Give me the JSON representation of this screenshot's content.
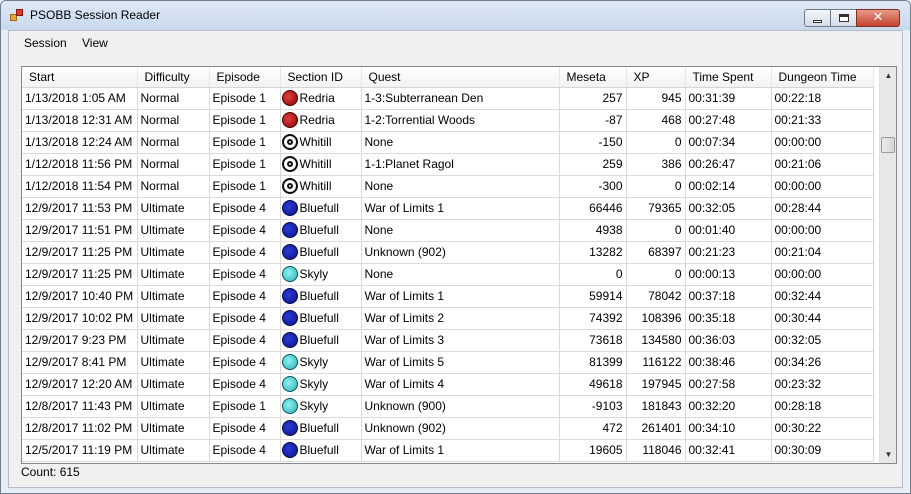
{
  "window": {
    "title": "PSOBB Session Reader"
  },
  "menu": {
    "items": [
      "Session",
      "View"
    ]
  },
  "columns": [
    "Start",
    "Difficulty",
    "Episode",
    "Section ID",
    "Quest",
    "Meseta",
    "XP",
    "Time Spent",
    "Dungeon Time"
  ],
  "section_icons": {
    "Redria": "red",
    "Whitill": "white",
    "Bluefull": "blue",
    "Skyly": "cyan"
  },
  "rows": [
    [
      "1/13/2018 1:05 AM",
      "Normal",
      "Episode 1",
      "Redria",
      "1-3:Subterranean Den",
      "257",
      "945",
      "00:31:39",
      "00:22:18"
    ],
    [
      "1/13/2018 12:31 AM",
      "Normal",
      "Episode 1",
      "Redria",
      "1-2:Torrential Woods",
      "-87",
      "468",
      "00:27:48",
      "00:21:33"
    ],
    [
      "1/13/2018 12:24 AM",
      "Normal",
      "Episode 1",
      "Whitill",
      "None",
      "-150",
      "0",
      "00:07:34",
      "00:00:00"
    ],
    [
      "1/12/2018 11:56 PM",
      "Normal",
      "Episode 1",
      "Whitill",
      "1-1:Planet Ragol",
      "259",
      "386",
      "00:26:47",
      "00:21:06"
    ],
    [
      "1/12/2018 11:54 PM",
      "Normal",
      "Episode 1",
      "Whitill",
      "None",
      "-300",
      "0",
      "00:02:14",
      "00:00:00"
    ],
    [
      "12/9/2017 11:53 PM",
      "Ultimate",
      "Episode 4",
      "Bluefull",
      "War of Limits 1",
      "66446",
      "79365",
      "00:32:05",
      "00:28:44"
    ],
    [
      "12/9/2017 11:51 PM",
      "Ultimate",
      "Episode 4",
      "Bluefull",
      "None",
      "4938",
      "0",
      "00:01:40",
      "00:00:00"
    ],
    [
      "12/9/2017 11:25 PM",
      "Ultimate",
      "Episode 4",
      "Bluefull",
      "Unknown (902)",
      "13282",
      "68397",
      "00:21:23",
      "00:21:04"
    ],
    [
      "12/9/2017 11:25 PM",
      "Ultimate",
      "Episode 4",
      "Skyly",
      "None",
      "0",
      "0",
      "00:00:13",
      "00:00:00"
    ],
    [
      "12/9/2017 10:40 PM",
      "Ultimate",
      "Episode 4",
      "Bluefull",
      "War of Limits 1",
      "59914",
      "78042",
      "00:37:18",
      "00:32:44"
    ],
    [
      "12/9/2017 10:02 PM",
      "Ultimate",
      "Episode 4",
      "Bluefull",
      "War of Limits 2",
      "74392",
      "108396",
      "00:35:18",
      "00:30:44"
    ],
    [
      "12/9/2017 9:23 PM",
      "Ultimate",
      "Episode 4",
      "Bluefull",
      "War of Limits 3",
      "73618",
      "134580",
      "00:36:03",
      "00:32:05"
    ],
    [
      "12/9/2017 8:41 PM",
      "Ultimate",
      "Episode 4",
      "Skyly",
      "War of Limits 5",
      "81399",
      "116122",
      "00:38:46",
      "00:34:26"
    ],
    [
      "12/9/2017 12:20 AM",
      "Ultimate",
      "Episode 4",
      "Skyly",
      "War of Limits 4",
      "49618",
      "197945",
      "00:27:58",
      "00:23:32"
    ],
    [
      "12/8/2017 11:43 PM",
      "Ultimate",
      "Episode 1",
      "Skyly",
      "Unknown (900)",
      "-9103",
      "181843",
      "00:32:20",
      "00:28:18"
    ],
    [
      "12/8/2017 11:02 PM",
      "Ultimate",
      "Episode 4",
      "Bluefull",
      "Unknown (902)",
      "472",
      "261401",
      "00:34:10",
      "00:30:22"
    ],
    [
      "12/5/2017 11:19 PM",
      "Ultimate",
      "Episode 4",
      "Bluefull",
      "War of Limits 1",
      "19605",
      "118046",
      "00:32:41",
      "00:30:09"
    ]
  ],
  "status": {
    "count_text": "Count: 615"
  }
}
